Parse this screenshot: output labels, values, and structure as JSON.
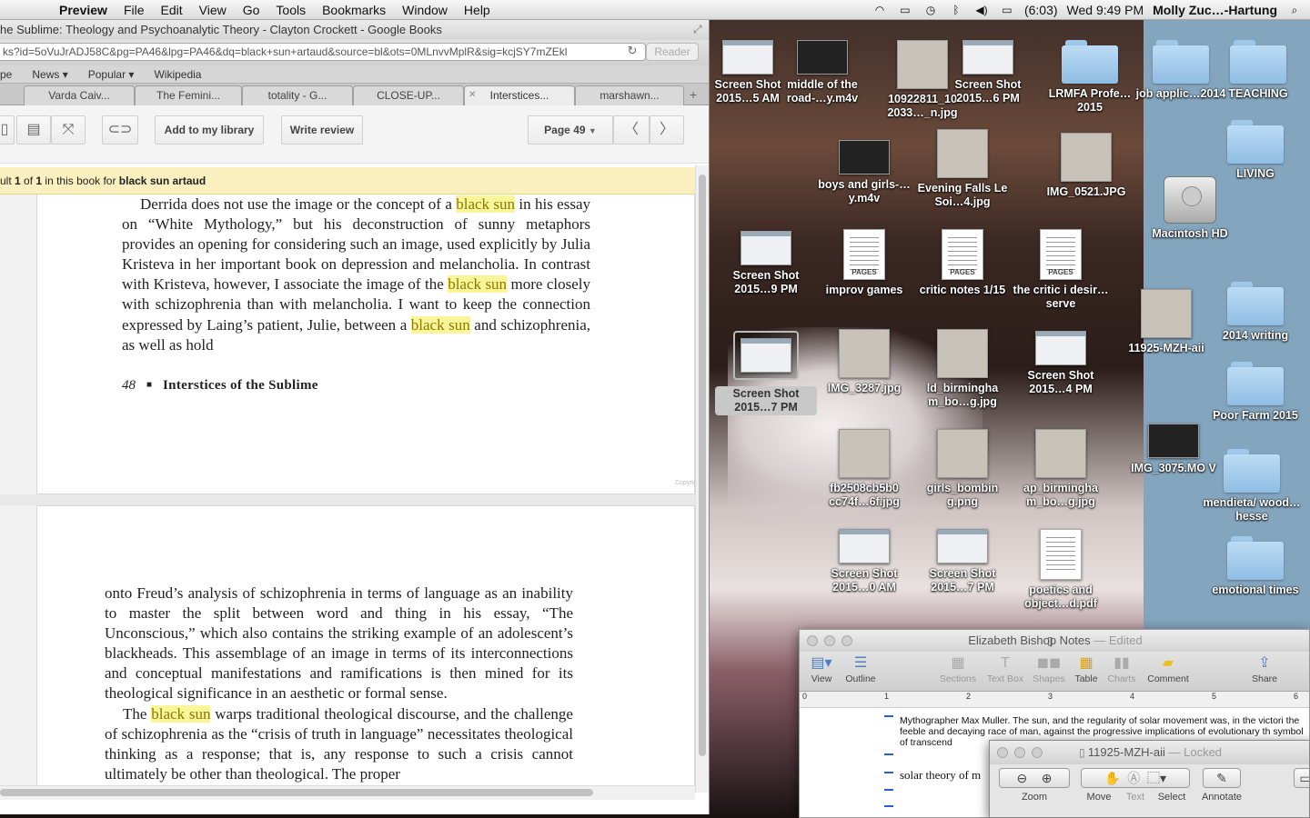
{
  "menubar": {
    "app_name": "Preview",
    "menus": [
      "File",
      "Edit",
      "View",
      "Go",
      "Tools",
      "Bookmarks",
      "Window",
      "Help"
    ],
    "battery": "(6:03)",
    "clock": "Wed 9:49 PM",
    "user": "Molly Zuc…-Hartung"
  },
  "browser": {
    "title": "he Sublime: Theology and Psychoanalytic Theory - Clayton Crockett - Google Books",
    "url": "ks?id=5oVuJrADJ58C&pg=PA46&lpg=PA46&dq=black+sun+artaud&source=bl&ots=0MLnvvMplR&sig=kcjSY7mZEkl",
    "reader": "Reader",
    "bookmarks": [
      "pe",
      "News ▾",
      "Popular ▾",
      "Wikipedia"
    ],
    "tabs": [
      "Varda Caiv...",
      "The Femini...",
      "totality - G...",
      "CLOSE-UP...",
      "Interstices...",
      "marshawn..."
    ],
    "active_tab": 4
  },
  "gbooks": {
    "add_library": "Add to my library",
    "write_review": "Write review",
    "page_select": "Page 49",
    "result": {
      "prefix": "ult ",
      "n": "1",
      "of": " of ",
      "total": "1",
      "mid": " in this book for ",
      "query": "black sun artaud"
    },
    "page1": {
      "segments": [
        {
          "t": "Derrida does not use the image or the concept of a "
        },
        {
          "t": "black sun",
          "hl": true
        },
        {
          "t": " in his essay on “White Mythology,” but his deconstruction of sunny metaphors provides an opening for considering such an image, used explicitly by Julia Kristeva in her important book on depression and melancholia. In contrast with Kristeva, however, I associate the image of the "
        },
        {
          "t": "black sun",
          "hl": true
        },
        {
          "t": " more closely with schizophrenia than with melancholia. I want to keep the connection expressed by Laing’s patient, Julie, between a "
        },
        {
          "t": "black sun",
          "hl": true
        },
        {
          "t": " and schizophrenia, as well as hold"
        }
      ],
      "folio": "48",
      "running_head": "Interstices of the Sublime",
      "copyright": "Copyrig"
    },
    "page2": {
      "segments": [
        {
          "t": "onto Freud’s analysis of schizophrenia in terms of language as an inability to master the split between word and thing in his essay, “The Unconscious,” which also contains the striking example of an adolescent’s blackheads. This assemblage of an image in terms of its interconnections and conceptual manifestations and ramifications is then mined for its theological significance in an aesthetic or formal sense."
        },
        {
          "t": "The ",
          "indent": true
        },
        {
          "t": "black sun",
          "hl": true
        },
        {
          "t": " warps traditional theological discourse, and the challenge of schizophrenia as the “crisis of truth in language” necessitates theological thinking as a response; that is, any response to such a crisis cannot ultimately be other than theological. The proper"
        }
      ]
    }
  },
  "desktop_icons": [
    {
      "label": "Screen Shot 2015…5 AM",
      "kind": "shot"
    },
    {
      "label": "middle of the road-…y.m4v",
      "kind": "video"
    },
    {
      "label": "10922811_10 2033…_n.jpg",
      "kind": "photo"
    },
    {
      "label": "Screen Shot 2015…6 PM",
      "kind": "shot"
    },
    {
      "label": "LRMFA Profe…2015",
      "kind": "folder"
    },
    {
      "label": "job applic…2014",
      "kind": "folder"
    },
    {
      "label": "TEACHING",
      "kind": "folder"
    },
    {
      "label": "boys and girls-…y.m4v",
      "kind": "video"
    },
    {
      "label": "Evening Falls Le Soi…4.jpg",
      "kind": "photo"
    },
    {
      "label": "IMG_0521.JPG",
      "kind": "photo"
    },
    {
      "label": "LIVING",
      "kind": "folder"
    },
    {
      "label": "Macintosh HD",
      "kind": "disk"
    },
    {
      "label": "Screen Shot 2015…9 PM",
      "kind": "shot"
    },
    {
      "label": "improv games",
      "kind": "pages",
      "tag": "PAGES"
    },
    {
      "label": "critic notes 1/15",
      "kind": "pages",
      "tag": "PAGES"
    },
    {
      "label": "the critic i desir…serve",
      "kind": "pages",
      "tag": "PAGES"
    },
    {
      "label": "11925-MZH-aii",
      "kind": "photo"
    },
    {
      "label": "2014 writing",
      "kind": "folder"
    },
    {
      "label": "Screen Shot 2015…7 PM",
      "kind": "shot"
    },
    {
      "label": "IMG_3287.jpg",
      "kind": "photo"
    },
    {
      "label": "ld_birmingha m_bo…g.jpg",
      "kind": "photo"
    },
    {
      "label": "Screen Shot 2015…4 PM",
      "kind": "shot"
    },
    {
      "label": "Poor Farm 2015",
      "kind": "folder"
    },
    {
      "label": "fb2508cb5b0 cc74f…6f.jpg",
      "kind": "photo"
    },
    {
      "label": "girls_bombin g.png",
      "kind": "photo"
    },
    {
      "label": "ap_birmingha m_bo…g.jpg",
      "kind": "photo"
    },
    {
      "label": "IMG_3075.MO V",
      "kind": "video"
    },
    {
      "label": "mendieta/ wood…hesse",
      "kind": "folder"
    },
    {
      "label": "Screen Shot 2015…0 AM",
      "kind": "shot"
    },
    {
      "label": "Screen Shot 2015…7 PM",
      "kind": "shot"
    },
    {
      "label": "poetics and object…d.pdf",
      "kind": "pdf"
    },
    {
      "label": "emotional times",
      "kind": "folder"
    }
  ],
  "pages_window": {
    "title": "Elizabeth Bishop Notes",
    "edited": " — Edited",
    "tools": [
      "View",
      "Outline",
      "Sections",
      "Text Box",
      "Shapes",
      "Table",
      "Charts",
      "Comment",
      "Share"
    ],
    "ruler": [
      "0",
      "1",
      "2",
      "3",
      "4",
      "5",
      "6"
    ],
    "text1": "Mythographer Max Muller. The sun, and the regularity of solar movement was, in the victori the feeble and decaying race of man, against the progressive implications of evolutionary th symbol of transcend",
    "text2": "solar theory of m"
  },
  "preview_window": {
    "title": "11925-MZH-aii",
    "locked": " — Locked",
    "labels": [
      "Zoom",
      "Move",
      "Text",
      "Select",
      "Annotate"
    ]
  }
}
